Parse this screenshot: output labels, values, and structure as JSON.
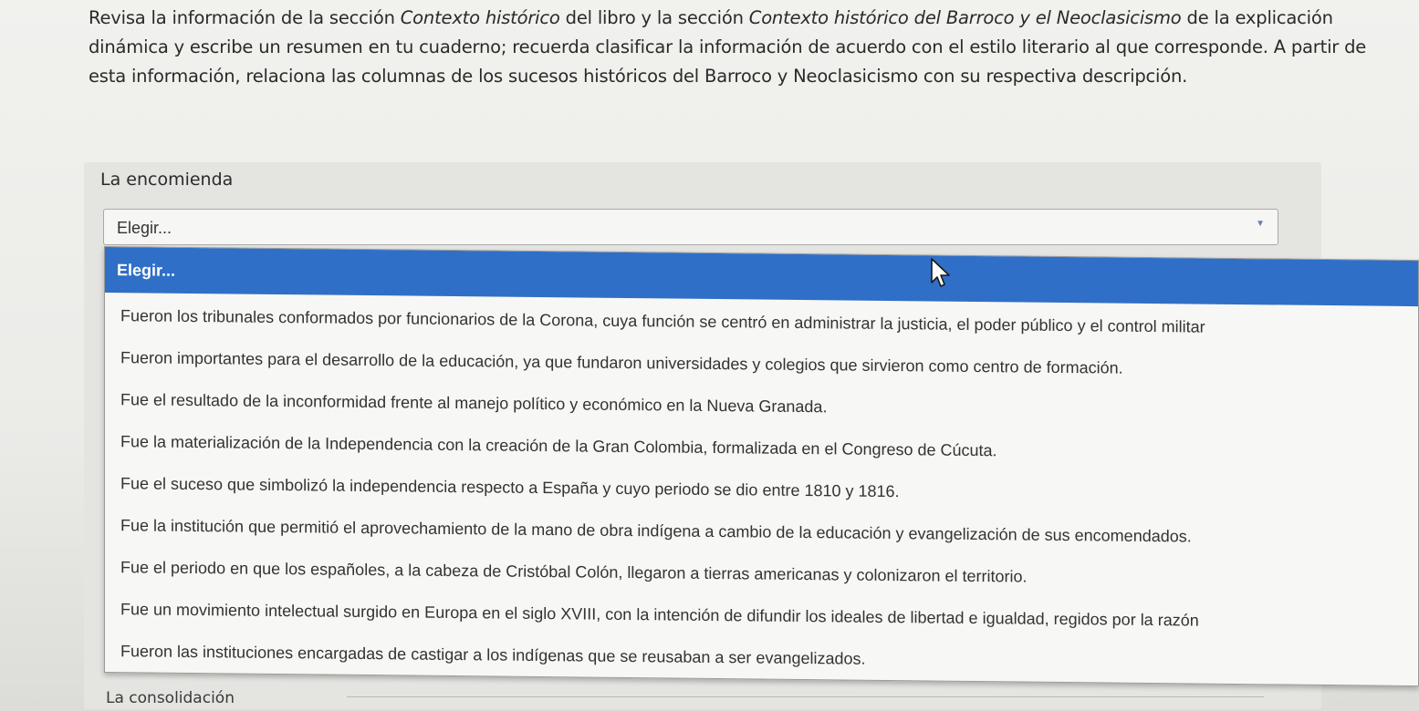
{
  "instructions": {
    "part1": "Revisa la información de la sección ",
    "italic1": "Contexto histórico",
    "part2": " del libro y la sección ",
    "italic2": "Contexto histórico del Barroco y el Neoclasicismo",
    "part3": " de la explicación dinámica y escribe un resumen en tu cuaderno; recuerda clasificar la información de acuerdo con el estilo literario al que corresponde. A partir de esta información, relaciona las columnas de los sucesos históricos del Barroco y Neoclasicismo con su respectiva descripción."
  },
  "question": {
    "label": "La encomienda",
    "select_value": "Elegir...",
    "caret_icon": "triangle-down"
  },
  "dropdown": {
    "selected_option": "Elegir...",
    "options": [
      "Fueron los tribunales conformados por funcionarios de la Corona, cuya función se centró en administrar la justicia, el poder público y el control militar",
      "Fueron importantes para el desarrollo de la educación, ya que fundaron universidades y colegios que sirvieron como centro de formación.",
      "Fue el resultado de la inconformidad frente al manejo político y económico en la Nueva Granada.",
      "Fue la materialización de la Independencia con la creación de la Gran Colombia, formalizada en el Congreso de Cúcuta.",
      "Fue el suceso que simbolizó la independencia respecto a España y cuyo periodo se dio entre 1810 y 1816.",
      "Fue la institución que permitió el aprovechamiento de la mano de obra indígena a cambio de la educación y evangelización de sus encomendados.",
      "Fue el periodo en que los españoles, a la cabeza de Cristóbal Colón, llegaron a tierras americanas y colonizaron el territorio.",
      "Fue un movimiento intelectual surgido en Europa en el siglo XVIII, con la intención de difundir los ideales de libertad e igualdad, regidos por la razón",
      "Fueron las instituciones encargadas de castigar a los indígenas que se reusaban a ser evangelizados."
    ]
  },
  "next_question": {
    "label": "La consolidación"
  },
  "colors": {
    "selected_bg": "#2f6fc7",
    "text": "#333333",
    "background": "#ebebe8"
  }
}
